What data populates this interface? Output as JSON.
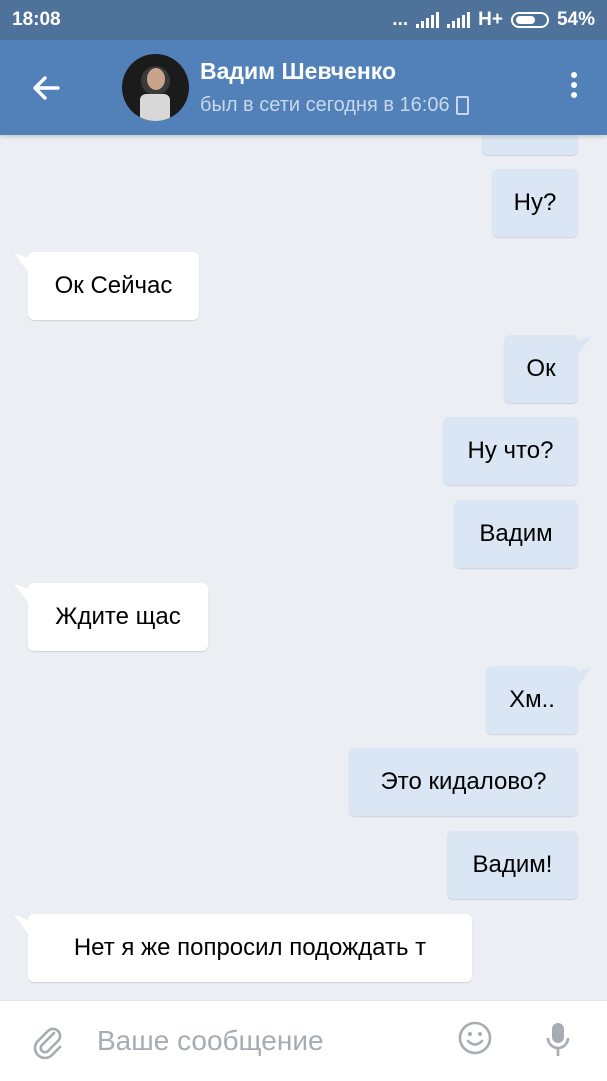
{
  "status_bar": {
    "time": "18:08",
    "dots": "...",
    "network": "H+",
    "battery": "54%"
  },
  "header": {
    "contact_name": "Вадим Шевченко",
    "last_seen": "был в сети сегодня в 16:06",
    "back_icon": "arrow-left-icon",
    "menu_icon": "more-vertical-icon"
  },
  "messages": [
    {
      "direction": "out",
      "text": "Ну?"
    },
    {
      "direction": "in",
      "text": "Ок Сейчас"
    },
    {
      "direction": "out",
      "text": "Ок"
    },
    {
      "direction": "out",
      "text": "Ну что?"
    },
    {
      "direction": "out",
      "text": "Вадим"
    },
    {
      "direction": "in",
      "text": "Ждите щас"
    },
    {
      "direction": "out",
      "text": "Хм.."
    },
    {
      "direction": "out",
      "text": "Это кидалово?"
    },
    {
      "direction": "out",
      "text": "Вадим!"
    },
    {
      "direction": "in",
      "text": "Нет я же попросил подождать т"
    }
  ],
  "composer": {
    "placeholder": "Ваше сообщение",
    "attach_icon": "paperclip-icon",
    "emoji_icon": "smile-icon",
    "mic_icon": "microphone-icon"
  },
  "colors": {
    "header": "#5181b8",
    "status_bar": "#4e729a",
    "chat_background": "#ebeff4",
    "outgoing_bubble": "#dae6f3",
    "incoming_bubble": "#ffffff"
  }
}
